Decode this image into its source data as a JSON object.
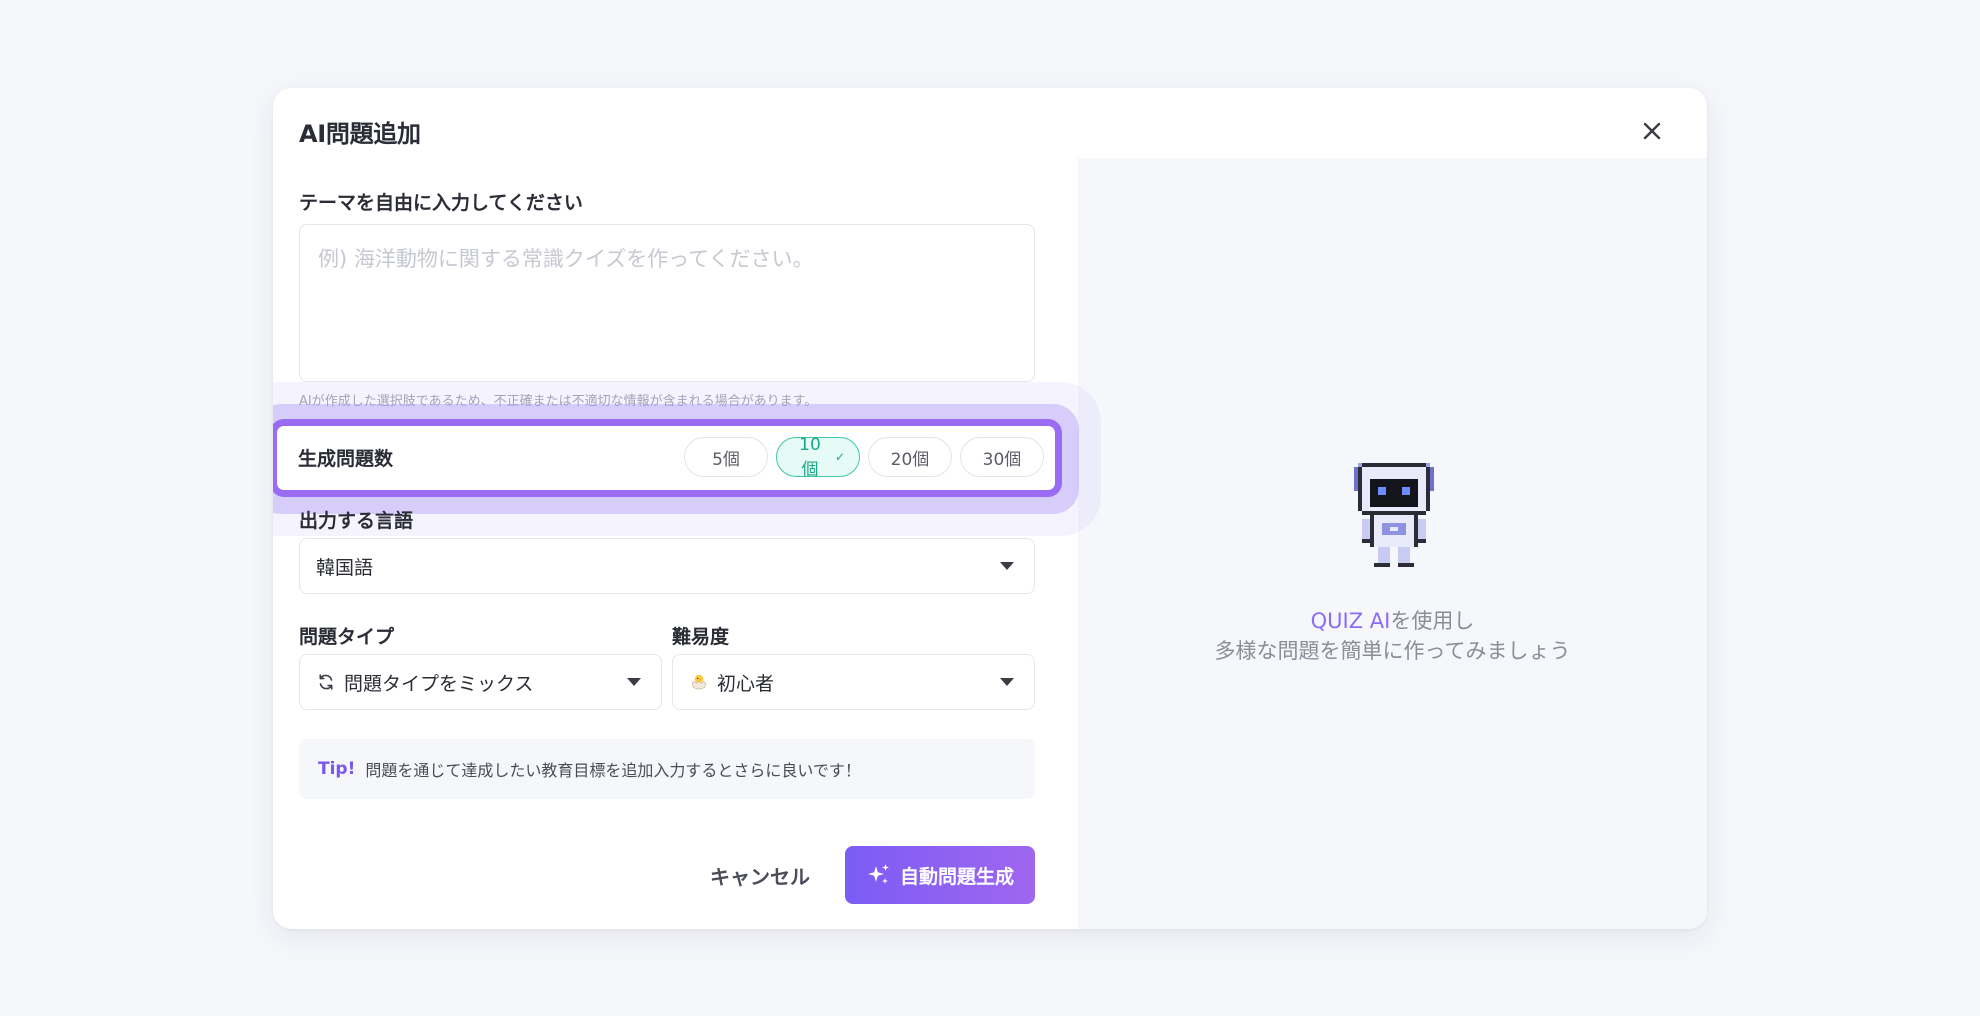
{
  "modal": {
    "title": "AI問題追加"
  },
  "theme": {
    "label": "テーマを自由に入力してください",
    "placeholder": "例) 海洋動物に関する常識クイズを作ってください。",
    "value": "",
    "disclaimer": "AIが作成した選択肢であるため、不正確または不適切な情報が含まれる場合があります。"
  },
  "question_count": {
    "label": "生成問題数",
    "options": [
      "5個",
      "10個",
      "20個",
      "30個"
    ],
    "selected": "10個",
    "check_mark": "✓"
  },
  "language": {
    "label": "出力する言語",
    "value": "韓国語"
  },
  "question_type": {
    "label": "問題タイプ",
    "value": "問題タイプをミックス",
    "icon": "refresh-icon"
  },
  "difficulty": {
    "label": "難易度",
    "value": "初心者",
    "icon": "hatching-chick-icon"
  },
  "tip": {
    "label": "Tip!",
    "text": "問題を通じて達成したい教育目標を追加入力するとさらに良いです！"
  },
  "actions": {
    "cancel_label": "キャンセル",
    "generate_label": "自動問題生成",
    "generate_icon": "sparkles-icon"
  },
  "promo": {
    "brand": "QUIZ AI",
    "line1_suffix": "を使用し",
    "line2": "多様な問題を簡単に作ってみましょう"
  },
  "colors": {
    "accent": "#8b6cf7",
    "selected_chip": "#3cc9a6",
    "highlight": "#9a6cf4"
  }
}
